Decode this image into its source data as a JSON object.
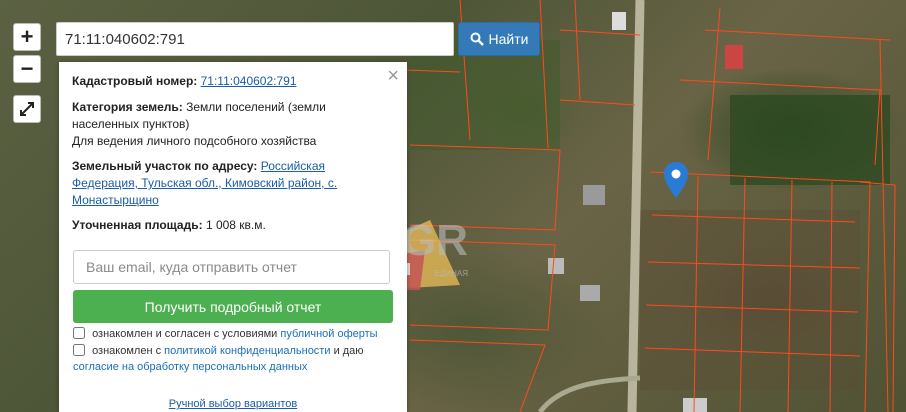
{
  "search": {
    "value": "71:11:040602:791",
    "button_label": "Найти"
  },
  "zoom": {
    "in_label": "+",
    "out_label": "−"
  },
  "panel": {
    "cadastral_label": "Кадастровый номер:",
    "cadastral_value": "71:11:040602:791",
    "category_label": "Категория земель:",
    "category_value": "Земли поселений (земли населенных пунктов)",
    "usage": "Для ведения личного подсобного хозяйства",
    "address_label": "Земельный участок по адресу:",
    "address_value": "Российская Федерация, Тульская обл., Кимовский район, с. Монастырщино",
    "area_label": "Уточненная площадь:",
    "area_value": "1 008 кв.м.",
    "email_placeholder": "Ваш email, куда отправить отчет",
    "report_button": "Получить подробный отчет",
    "consent1_text": "ознакомлен и согласен с условиями",
    "consent1_link": "публичной оферты",
    "consent2_text1": "ознакомлен с",
    "consent2_link1": "политикой конфиденциальности",
    "consent2_text2": "и даю",
    "consent2_link2": "согласие на обработку персональных данных",
    "manual_link": "Ручной выбор вариантов"
  },
  "watermark": {
    "text": "EGR",
    "subtext": "ЕДИНАЯ"
  },
  "colors": {
    "accent": "#337ab7",
    "report_button": "#4cb050",
    "parcel_lines": "#ff4a1c",
    "marker": "#2a7bd6"
  }
}
